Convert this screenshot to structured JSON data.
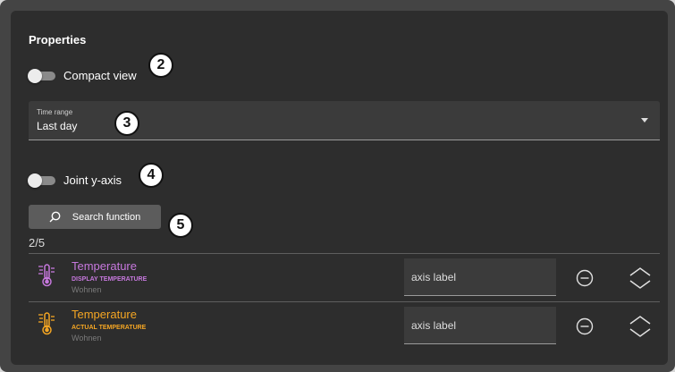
{
  "panel": {
    "title": "Properties"
  },
  "compact_view": {
    "label": "Compact view",
    "on": false
  },
  "time_range": {
    "label": "Time range",
    "value": "Last day"
  },
  "joint_y_axis": {
    "label": "Joint y-axis",
    "on": false
  },
  "search_button": {
    "label": "Search function"
  },
  "callouts": [
    "2",
    "3",
    "4",
    "5"
  ],
  "selection_count": "2/5",
  "functions": [
    {
      "name": "Temperature",
      "subtitle": "DISPLAY TEMPERATURE",
      "location": "Wohnen",
      "color": "#c678dd",
      "axis_label_placeholder": "axis label",
      "icon": "thermometer-icon"
    },
    {
      "name": "Temperature",
      "subtitle": "ACTUAL TEMPERATURE",
      "location": "Wohnen",
      "color": "#f5a623",
      "axis_label_placeholder": "axis label",
      "icon": "thermometer-icon"
    }
  ],
  "colors": {
    "panel_bg": "#2d2d2d",
    "frame_bg": "#444444",
    "row1_accent": "#c678dd",
    "row2_accent": "#f5a623"
  }
}
